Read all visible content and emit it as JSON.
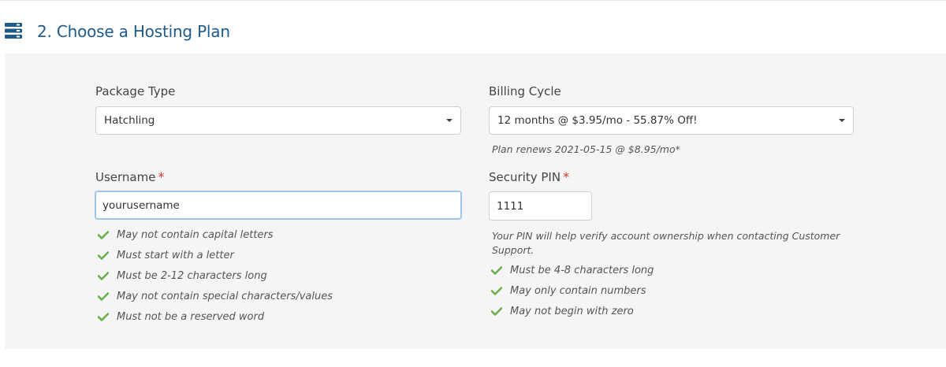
{
  "section": {
    "title": "2. Choose a Hosting Plan",
    "icon": "server-stack-icon",
    "accent_color": "#1e5a8a"
  },
  "package_type": {
    "label": "Package Type",
    "selected": "Hatchling"
  },
  "billing_cycle": {
    "label": "Billing Cycle",
    "selected": "12 months @ $3.95/mo - 55.87% Off!",
    "renewal_note": "Plan renews 2021-05-15 @ $8.95/mo*"
  },
  "username": {
    "label": "Username",
    "required_mark": "*",
    "value": "yourusername",
    "rules": [
      "May not contain capital letters",
      "Must start with a letter",
      "Must be 2-12 characters long",
      "May not contain special characters/values",
      "Must not be a reserved word"
    ]
  },
  "security_pin": {
    "label": "Security PIN",
    "required_mark": "*",
    "value": "1111",
    "note": "Your PIN will help verify account ownership when contacting Customer Support.",
    "rules": [
      "Must be 4-8 characters long",
      "May only contain numbers",
      "May not begin with zero"
    ]
  },
  "colors": {
    "check": "#6ab04c",
    "required": "#d0342c",
    "focus_border": "#9ec4ea"
  }
}
